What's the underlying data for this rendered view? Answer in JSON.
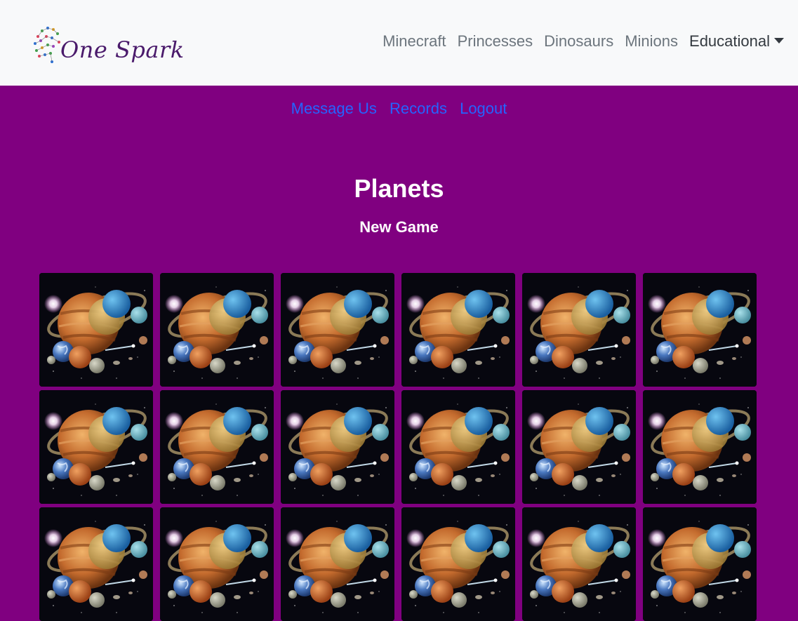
{
  "brand": {
    "name": "One Spark"
  },
  "nav": {
    "items": [
      {
        "label": "Minecraft"
      },
      {
        "label": "Princesses"
      },
      {
        "label": "Dinosaurs"
      },
      {
        "label": "Minions"
      }
    ],
    "dropdown": {
      "label": "Educational"
    }
  },
  "subnav": {
    "message": "Message Us",
    "records": "Records",
    "logout": "Logout"
  },
  "game": {
    "title": "Planets",
    "new_game": "New Game",
    "card_icon": "planets-card-back",
    "colors": {
      "background": "#800080",
      "navbar": "#f8f9fa",
      "link": "#2563ff",
      "nav_text": "#6c757d"
    }
  }
}
